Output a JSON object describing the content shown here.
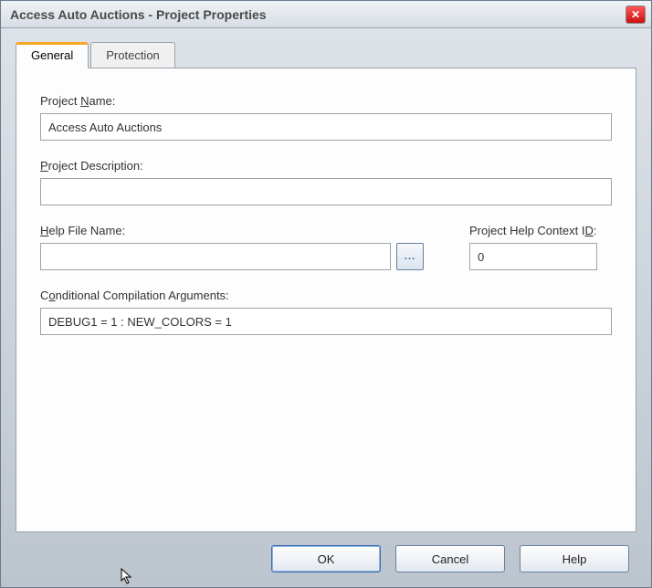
{
  "window": {
    "title": "Access Auto Auctions - Project Properties"
  },
  "tabs": {
    "general": "General",
    "protection": "Protection"
  },
  "labels": {
    "project_name_pre": "Project ",
    "project_name_u": "N",
    "project_name_post": "ame:",
    "project_desc": "Project Description:",
    "help_file_pre": "",
    "help_file_u": "H",
    "help_file_post": "elp File Name:",
    "context_pre": "Project Help Context I",
    "context_u": "D",
    "context_post": ":",
    "cond_comp_pre": "C",
    "cond_comp_u": "o",
    "cond_comp_post": "nditional Compilation Arguments:"
  },
  "values": {
    "project_name": "Access Auto Auctions",
    "project_description": "",
    "help_file": "",
    "context_id": "0",
    "cond_comp": "DEBUG1 = 1 : NEW_COLORS = 1",
    "browse": "..."
  },
  "buttons": {
    "ok": "OK",
    "cancel": "Cancel",
    "help": "Help"
  }
}
